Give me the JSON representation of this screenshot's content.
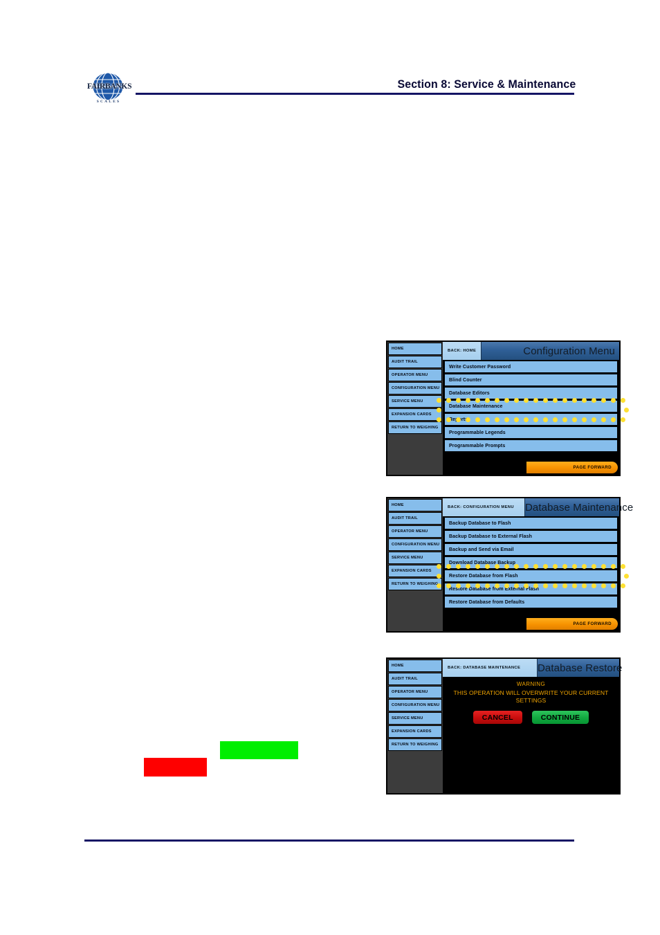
{
  "page": {
    "header_title": "Section 8:  Service & Maintenance",
    "logo": {
      "wordmark": "FAIRBANKS",
      "subtext": "SCALES",
      "icon": "globe-icon"
    }
  },
  "callouts": {
    "green_block": {
      "color": "#00ee00",
      "name": "green-highlight-block"
    },
    "red_block": {
      "color": "#fe0000",
      "name": "red-highlight-block"
    }
  },
  "nav_rail": {
    "items": [
      "HOME",
      "AUDIT TRAIL",
      "OPERATOR MENU",
      "CONFIGURATION MENU",
      "SERVICE MENU",
      "EXPANSION CARDS",
      "RETURN TO WEIGHING"
    ]
  },
  "screens": [
    {
      "id": "configuration-menu",
      "back_label": "BACK: HOME",
      "title": "Configuration Menu",
      "menu_items": [
        "Write Customer Password",
        "Blind Counter",
        "Database Editors",
        "Database Maintenance",
        "Reports",
        "Programmable Legends",
        "Programmable Prompts"
      ],
      "highlighted_item": "Database Maintenance",
      "page_forward_label": "PAGE FORWARD"
    },
    {
      "id": "database-maintenance",
      "back_label": "BACK: CONFIGURATION MENU",
      "title": "Database Maintenance",
      "menu_items": [
        "Backup Database to Flash",
        "Backup Database to External Flash",
        "Backup and Send via Email",
        "Download Database Backup",
        "Restore Database from Flash",
        "Restore Database from External Flash",
        "Restore Database from Defaults"
      ],
      "highlighted_item": "Restore Database from Flash",
      "page_forward_label": "PAGE FORWARD"
    },
    {
      "id": "database-restore",
      "back_label": "BACK: DATABASE MAINTENANCE",
      "title": "Database Restore",
      "warning_head": "WARNING",
      "warning_text": "THIS OPERATION WILL OVERWRITE YOUR CURRENT SETTINGS",
      "cancel_label": "CANCEL",
      "continue_label": "CONTINUE"
    }
  ],
  "colors": {
    "nav_button": "#86bdeb",
    "menu_item": "#86bdeb",
    "titlebar": "#2f5f97",
    "back_button": "#a6cfee",
    "page_forward": "#f79200",
    "warning_text": "#f0a400",
    "cancel": "#c90d0d",
    "continue": "#11a83f",
    "highlight_dot": "#ffe033",
    "rule": "#141464"
  }
}
